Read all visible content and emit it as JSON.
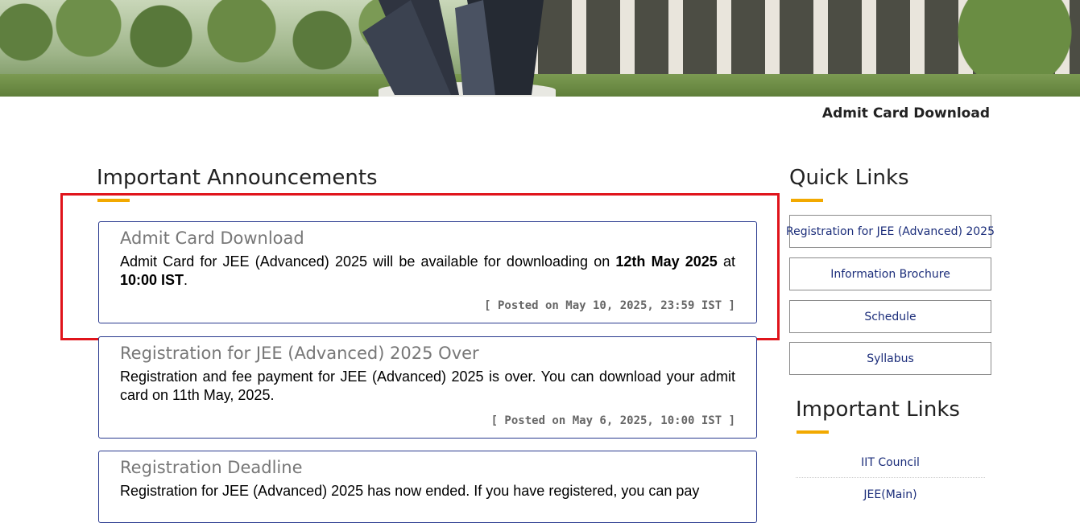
{
  "page_title": "Admit Card Download",
  "announcements": {
    "heading": "Important Announcements",
    "items": [
      {
        "title": "Admit Card Download",
        "body_parts": [
          "Admit Card for JEE (Advanced) 2025 will be available for downloading on ",
          "12th May 2025",
          " at ",
          "10:00 IST",
          "."
        ],
        "posted": "[ Posted on May 10, 2025, 23:59 IST ]"
      },
      {
        "title": "Registration for JEE (Advanced) 2025 Over",
        "body": "Registration and fee payment for JEE (Advanced) 2025 is over. You can download your admit card on 11th May, 2025.",
        "posted": "[ Posted on May 6, 2025, 10:00 IST ]"
      },
      {
        "title": "Registration Deadline",
        "body": "Registration for JEE (Advanced) 2025 has now ended. If you have registered, you can pay"
      }
    ]
  },
  "quick_links": {
    "heading": "Quick Links",
    "items": [
      {
        "label": "Registration for JEE (Advanced) 2025"
      },
      {
        "label": "Information Brochure"
      },
      {
        "label": "Schedule"
      },
      {
        "label": "Syllabus"
      }
    ]
  },
  "important_links": {
    "heading": "Important Links",
    "items": [
      {
        "label": "IIT Council"
      },
      {
        "label": "JEE(Main)"
      }
    ]
  },
  "colors": {
    "accent_underline": "#f2a900",
    "link_text": "#1b2d7a",
    "card_border": "#2a3a8f",
    "highlight_border": "#e0141b"
  }
}
